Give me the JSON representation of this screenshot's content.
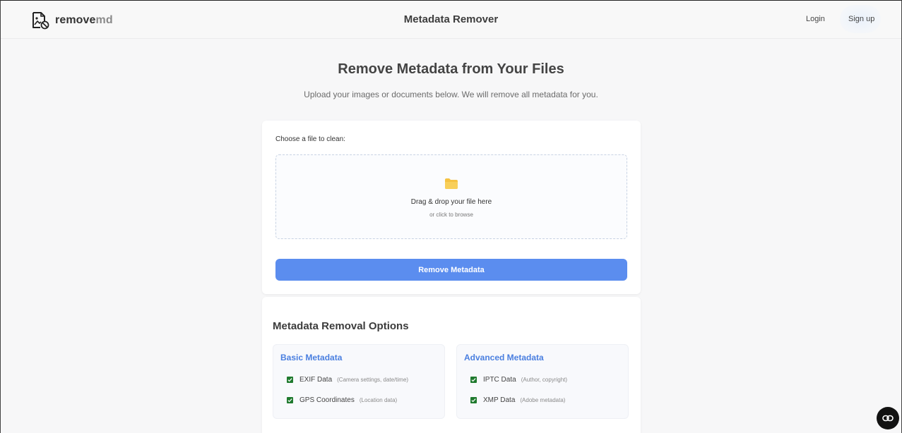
{
  "header": {
    "logo_text": "remove",
    "logo_text_suffix": "md",
    "title": "Metadata Remover",
    "login_label": "Login",
    "signup_label": "Sign up"
  },
  "hero": {
    "title": "Remove Metadata from Your Files",
    "subtitle": "Upload your images or documents below. We will remove all metadata for you."
  },
  "upload": {
    "label": "Choose a file to clean:",
    "drop_main": "Drag & drop your file here",
    "drop_sub": "or click to browse",
    "button_label": "Remove Metadata"
  },
  "options": {
    "title": "Metadata Removal Options",
    "groups": [
      {
        "title": "Basic Metadata",
        "items": [
          {
            "name": "EXIF Data",
            "desc": "(Camera settings, date/time)",
            "checked": true
          },
          {
            "name": "GPS Coordinates",
            "desc": "(Location data)",
            "checked": true
          }
        ]
      },
      {
        "title": "Advanced Metadata",
        "items": [
          {
            "name": "IPTC Data",
            "desc": "(Author, copyright)",
            "checked": true
          },
          {
            "name": "XMP Data",
            "desc": "(Adobe metadata)",
            "checked": true
          }
        ]
      }
    ]
  },
  "icons": {
    "logo": "file-image-remove-icon",
    "folder": "folder-icon",
    "checkbox": "checkmark-icon",
    "fab": "link-icon"
  },
  "colors": {
    "accent": "#5b8def",
    "group_title": "#4a7fe0",
    "checkbox": "#1f7a2e",
    "folder": "#f5c242"
  }
}
